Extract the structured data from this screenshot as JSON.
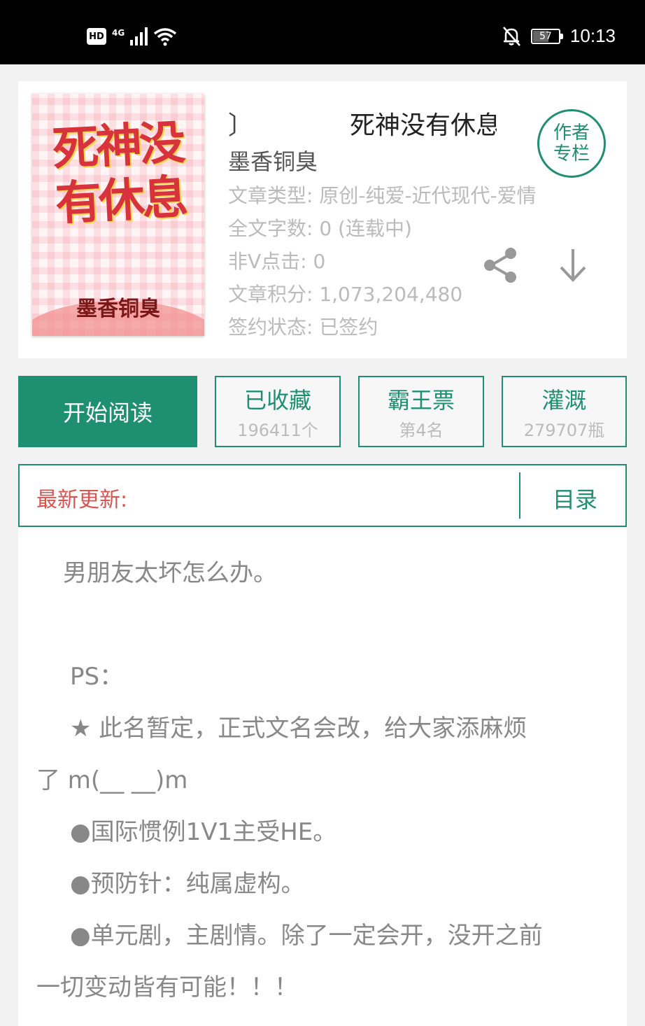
{
  "status_bar": {
    "hd": "HD",
    "network": "4G",
    "battery": "57",
    "battery_level": 0.57,
    "time": "10:13"
  },
  "book": {
    "title_prefix": "〕",
    "title": "死神没有休息",
    "author": "墨香铜臭",
    "cover": {
      "title": "死神没有休息",
      "author": "墨香铜臭"
    },
    "meta": [
      "文章类型: 原创-纯爱-近代现代-爱情",
      "全文字数: 0 (连载中)",
      "非V点击: 0",
      "文章积分: 1,073,204,480",
      "签约状态: 已签约"
    ],
    "author_badge": "作者\n专栏",
    "icons": {
      "share": "share-icon",
      "download": "download-icon"
    }
  },
  "actions": {
    "read": "开始阅读",
    "collect": {
      "label": "已收藏",
      "sub": "196411个"
    },
    "bawang": {
      "label": "霸王票",
      "sub": "第4名"
    },
    "guangai": {
      "label": "灌溉",
      "sub": "279707瓶"
    }
  },
  "latest": {
    "label": "最新更新:",
    "toc": "目录"
  },
  "summary": [
    "男朋友太坏怎么办。",
    "PS：",
    "★ 此名暂定，正式文名会改，给大家添麻烦",
    "了 m(__ __)m",
    "●国际惯例1V1主受HE。",
    "●预防针：纯属虚构。",
    "●单元剧，主剧情。除了一定会开，没开之前",
    "一切变动皆有可能！！！"
  ],
  "colors": {
    "accent": "#1f8f72",
    "update_red": "#d9534f"
  }
}
